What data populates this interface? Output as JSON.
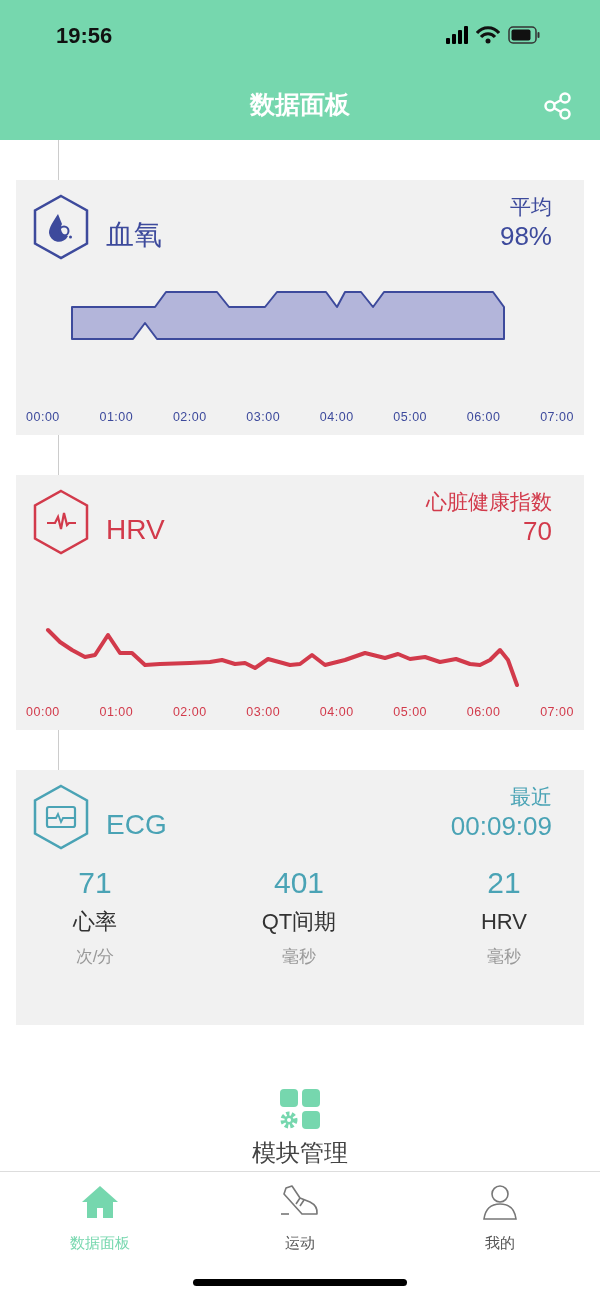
{
  "status_bar": {
    "time": "19:56"
  },
  "header": {
    "title": "数据面板"
  },
  "cards": [
    {
      "kind": "spo2",
      "color": "#3d4a9c",
      "title": "血氧",
      "summary_label": "平均",
      "summary_value": "98%",
      "x_labels": [
        "00:00",
        "01:00",
        "02:00",
        "03:00",
        "04:00",
        "05:00",
        "06:00",
        "07:00"
      ]
    },
    {
      "kind": "hrv",
      "color": "#d23a4b",
      "title": "HRV",
      "summary_label": "心脏健康指数",
      "summary_value": "70",
      "x_labels": [
        "00:00",
        "01:00",
        "02:00",
        "03:00",
        "04:00",
        "05:00",
        "06:00",
        "07:00"
      ]
    },
    {
      "kind": "ecg",
      "color": "#4aa3b5",
      "title": "ECG",
      "summary_label": "最近",
      "summary_value": "00:09:09",
      "metrics": [
        {
          "value": "71",
          "label": "心率",
          "unit": "次/分"
        },
        {
          "value": "401",
          "label": "QT间期",
          "unit": "毫秒"
        },
        {
          "value": "21",
          "label": "HRV",
          "unit": "毫秒"
        }
      ]
    }
  ],
  "module_button": {
    "label": "模块管理"
  },
  "tabs": [
    {
      "kind": "home",
      "label": "数据面板",
      "selected": true
    },
    {
      "kind": "sport",
      "label": "运动",
      "selected": false
    },
    {
      "kind": "profile",
      "label": "我的",
      "selected": false
    }
  ]
}
